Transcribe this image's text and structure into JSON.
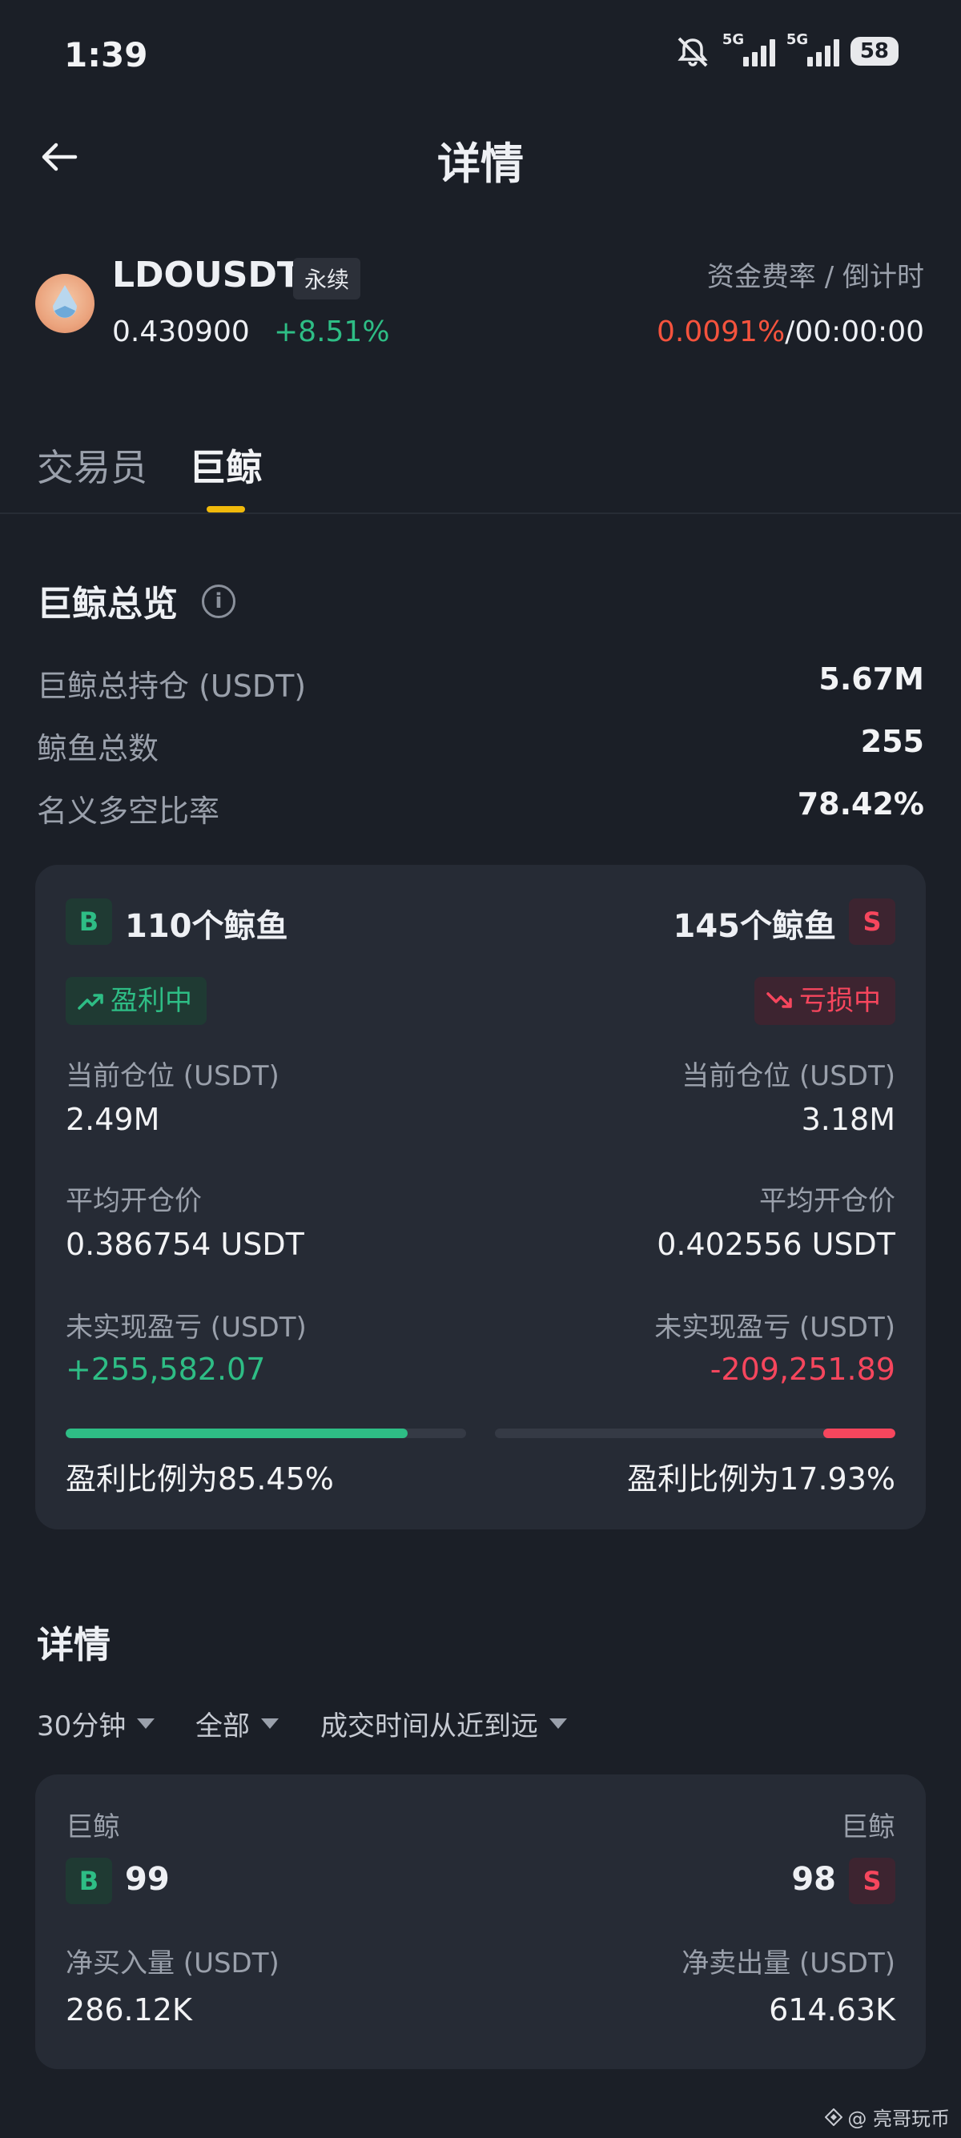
{
  "status": {
    "time": "1:39",
    "net1": "5G",
    "net2": "5G",
    "battery": "58"
  },
  "header": {
    "title": "详情"
  },
  "ticker": {
    "symbol": "LDOUSDT",
    "tag": "永续",
    "price": "0.430900",
    "change": "+8.51%",
    "rate_label": "资金费率 / 倒计时",
    "funding_rate": "0.0091%",
    "separator": "/",
    "countdown": "00:00:00"
  },
  "tabs": [
    {
      "label": "交易员"
    },
    {
      "label": "巨鲸"
    }
  ],
  "overview": {
    "title": "巨鲸总览",
    "info": "i",
    "rows": [
      {
        "label": "巨鲸总持仓 (USDT)",
        "value": "5.67M"
      },
      {
        "label": "鲸鱼总数",
        "value": "255"
      },
      {
        "label": "名义多空比率",
        "value": "78.42%"
      }
    ]
  },
  "long": {
    "tag": "B",
    "count": "110个鲸鱼",
    "status": "盈利中",
    "pos_label": "当前仓位 (USDT)",
    "pos_value": "2.49M",
    "avg_label": "平均开仓价",
    "avg_value": "0.386754 USDT",
    "pnl_label": "未实现盈亏 (USDT)",
    "pnl_value": "+255,582.07",
    "profit_ratio": "盈利比例为85.45%",
    "profit_fraction": 0.8545
  },
  "short": {
    "tag": "S",
    "count": "145个鲸鱼",
    "status": "亏损中",
    "pos_label": "当前仓位 (USDT)",
    "pos_value": "3.18M",
    "avg_label": "平均开仓价",
    "avg_value": "0.402556 USDT",
    "pnl_label": "未实现盈亏 (USDT)",
    "pnl_value": "-209,251.89",
    "profit_ratio": "盈利比例为17.93%",
    "profit_fraction": 0.1793
  },
  "details": {
    "title": "详情",
    "filters": [
      {
        "label": "30分钟"
      },
      {
        "label": "全部"
      },
      {
        "label": "成交时间从近到远"
      }
    ],
    "buy_label": "巨鲸",
    "buy_tag": "B",
    "buy_count": "99",
    "sell_label": "巨鲸",
    "sell_tag": "S",
    "sell_count": "98",
    "net_buy_label": "净买入量 (USDT)",
    "net_buy_value": "286.12K",
    "net_sell_label": "净卖出量 (USDT)",
    "net_sell_value": "614.63K"
  },
  "watermark": "@ 亮哥玩币",
  "colors": {
    "green": "#2ebd85",
    "red": "#f6465d",
    "accent": "#f0b90b",
    "rate": "#f5533d"
  }
}
